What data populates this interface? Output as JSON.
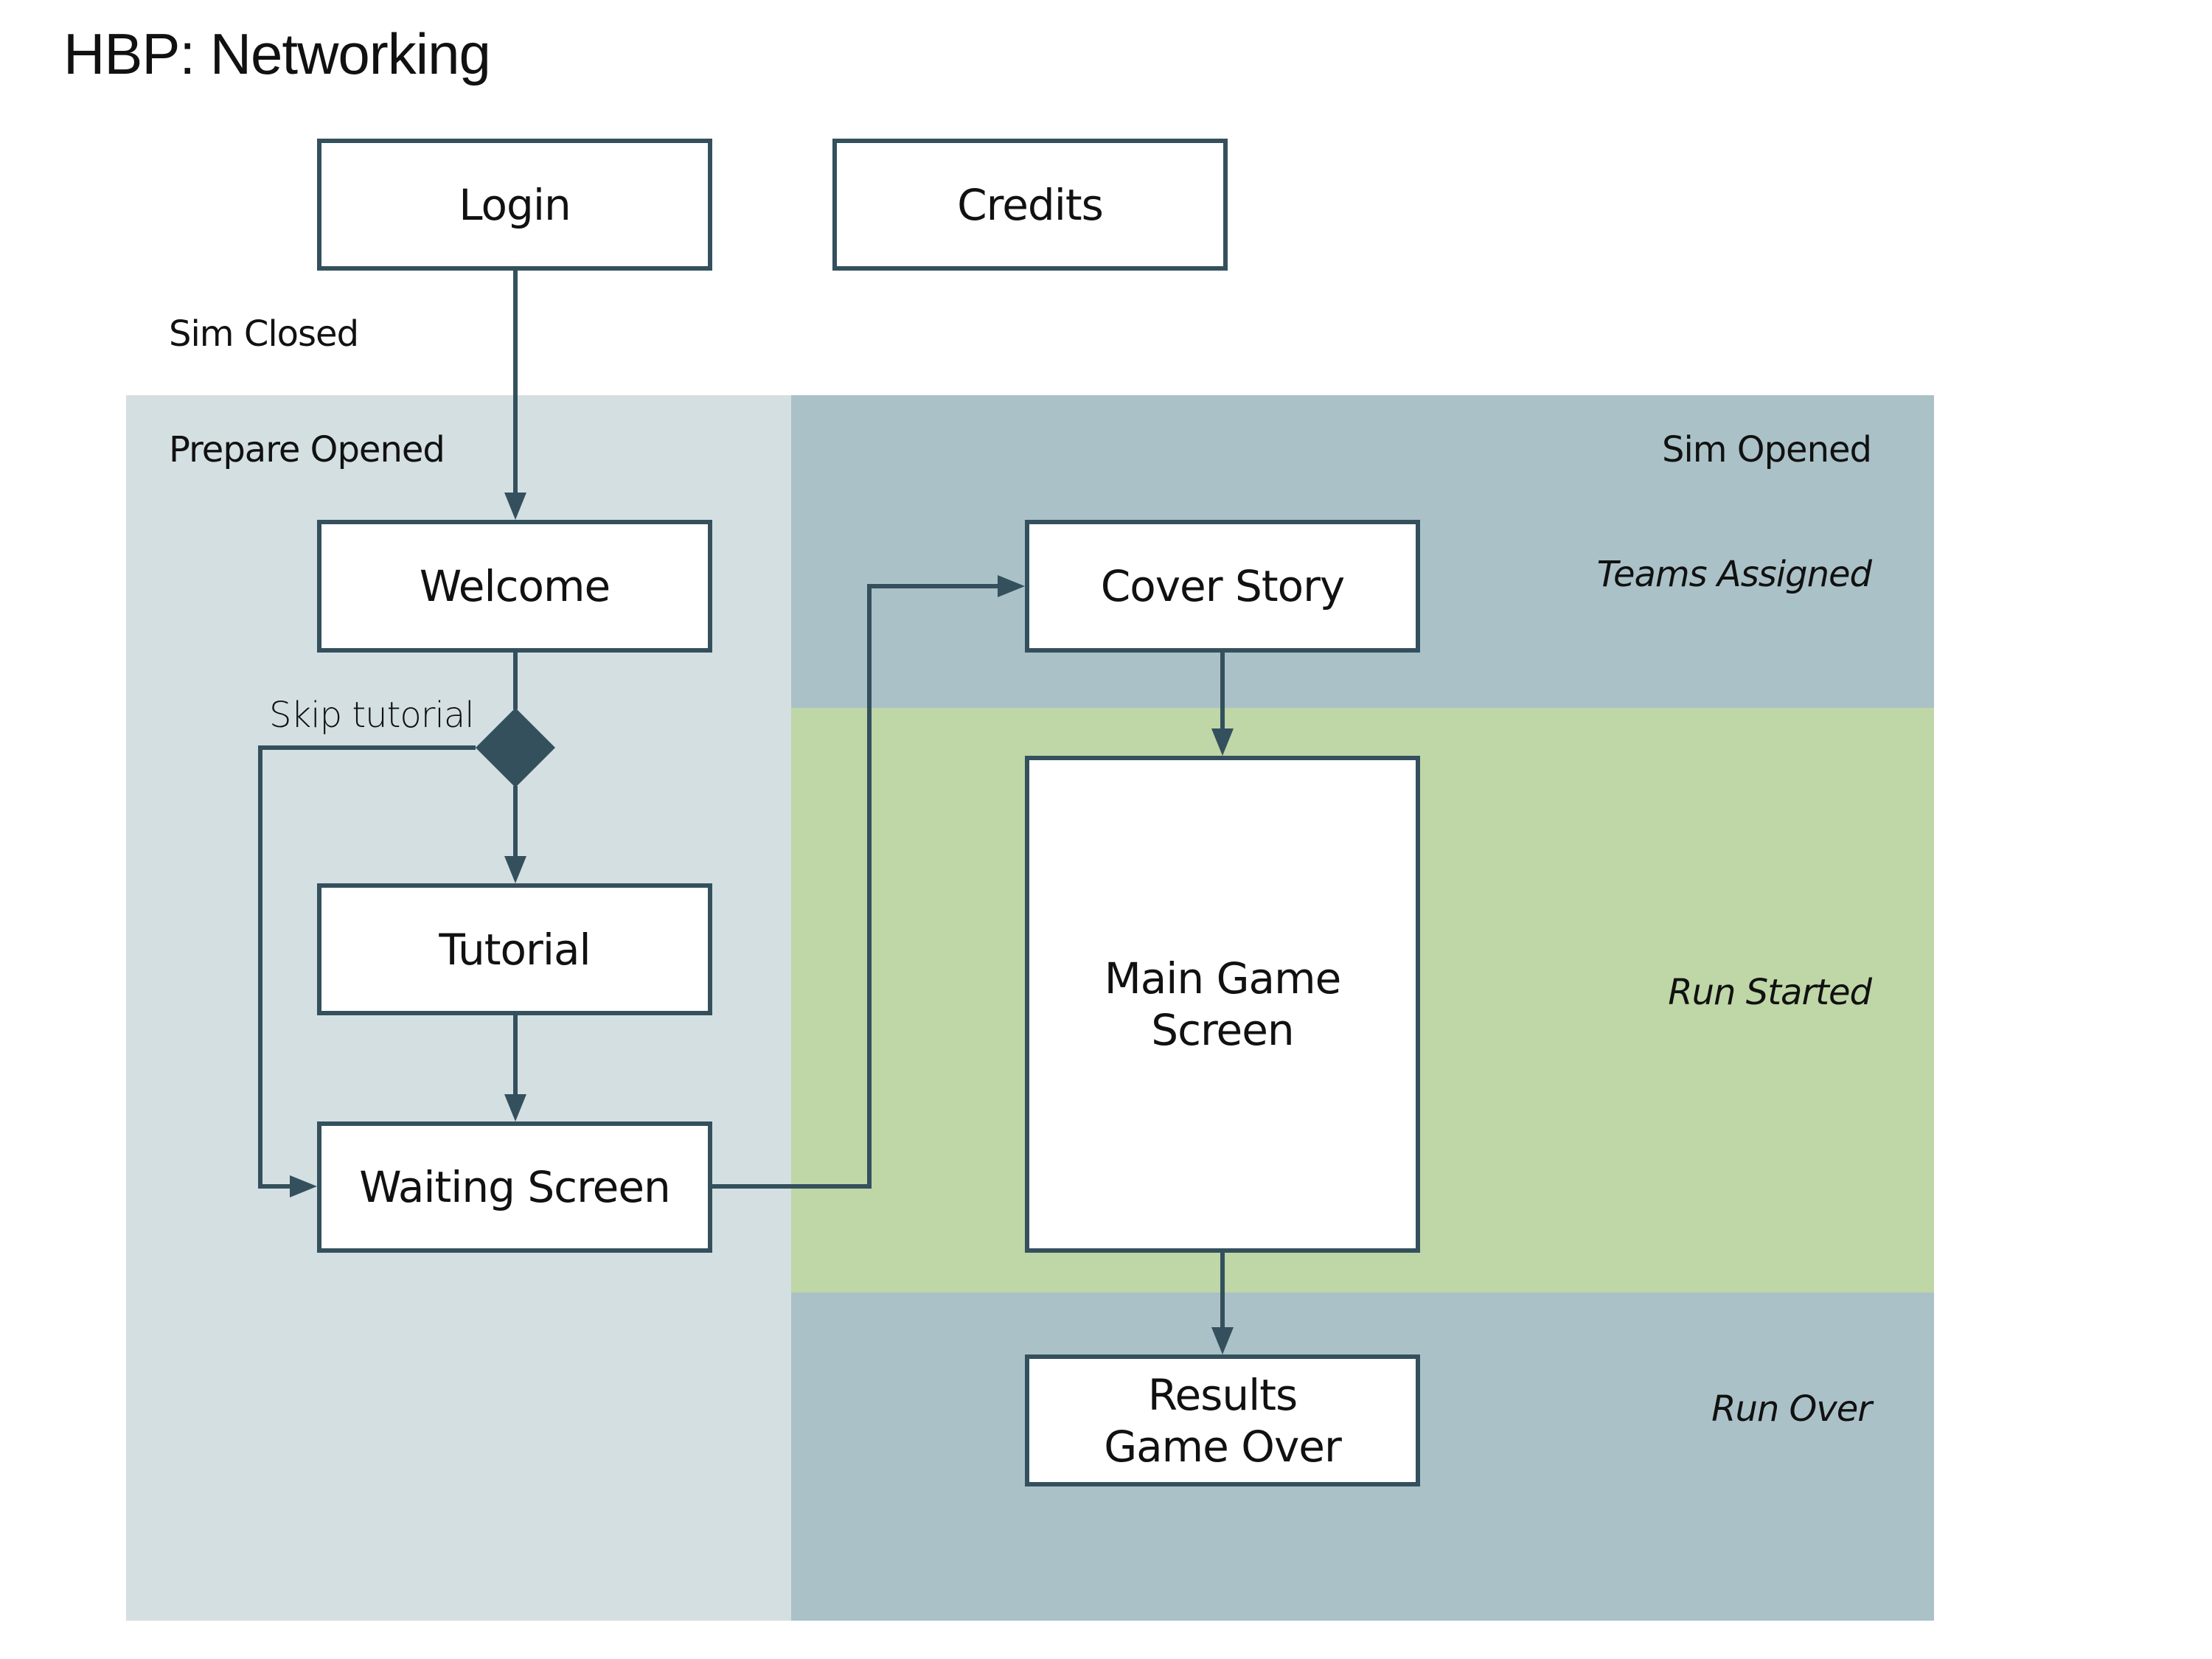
{
  "title": "HBP: Networking",
  "colors": {
    "stroke": "#34505d",
    "prepare_panel": "#d4dfe2",
    "sim_panel": "#aac1c7",
    "run_started_band": "#bfd6a7",
    "node_fill": "#ffffff"
  },
  "states": {
    "sim_closed": "Sim Closed",
    "prepare_opened": "Prepare Opened",
    "sim_opened": "Sim Opened",
    "teams_assigned": "Teams Assigned",
    "run_started": "Run Started",
    "run_over": "Run Over"
  },
  "nodes": {
    "login": "Login",
    "credits": "Credits",
    "welcome": "Welcome",
    "tutorial": "Tutorial",
    "waiting_screen": "Waiting Screen",
    "cover_story": "Cover Story",
    "main_game_screen": "Main Game\nScreen",
    "results": "Results\nGame Over"
  },
  "decision": {
    "skip_label": "Skip tutorial"
  },
  "edges": [
    {
      "from": "login",
      "to": "welcome"
    },
    {
      "from": "welcome",
      "to": "decision"
    },
    {
      "from": "decision",
      "to": "tutorial"
    },
    {
      "from": "decision",
      "to": "waiting_screen",
      "label": "Skip tutorial"
    },
    {
      "from": "tutorial",
      "to": "waiting_screen"
    },
    {
      "from": "waiting_screen",
      "to": "cover_story"
    },
    {
      "from": "cover_story",
      "to": "main_game_screen"
    },
    {
      "from": "main_game_screen",
      "to": "results"
    }
  ]
}
